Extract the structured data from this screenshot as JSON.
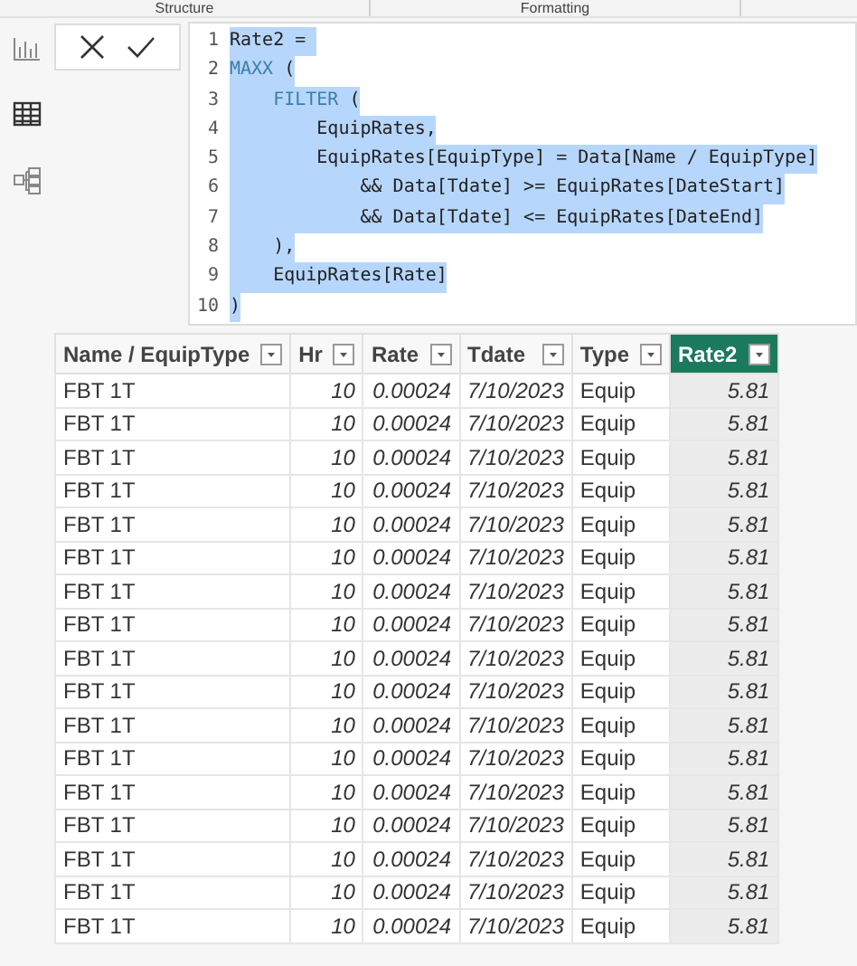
{
  "ribbon": {
    "groups": [
      "Structure",
      "Formatting"
    ]
  },
  "rail": {
    "items": [
      {
        "kind": "report",
        "selected": false
      },
      {
        "kind": "table",
        "selected": true
      },
      {
        "kind": "model",
        "selected": false
      }
    ]
  },
  "formula_bar": {
    "lines": [
      {
        "number": "1",
        "segments": [
          {
            "kind": "plain",
            "text": "Rate2 = "
          }
        ]
      },
      {
        "number": "2",
        "segments": [
          {
            "kind": "function",
            "text": "MAXX"
          },
          {
            "kind": "plain",
            "text": " ("
          }
        ]
      },
      {
        "number": "3",
        "segments": [
          {
            "kind": "function",
            "text": "    FILTER"
          },
          {
            "kind": "plain",
            "text": " ("
          }
        ]
      },
      {
        "number": "4",
        "segments": [
          {
            "kind": "plain",
            "text": "        EquipRates,"
          }
        ]
      },
      {
        "number": "5",
        "segments": [
          {
            "kind": "plain",
            "text": "        EquipRates[EquipType] = Data[Name / EquipType]"
          }
        ]
      },
      {
        "number": "6",
        "segments": [
          {
            "kind": "plain",
            "text": "            && Data[Tdate] >= EquipRates[DateStart]"
          }
        ]
      },
      {
        "number": "7",
        "segments": [
          {
            "kind": "plain",
            "text": "            && Data[Tdate] <= EquipRates[DateEnd]"
          }
        ]
      },
      {
        "number": "8",
        "segments": [
          {
            "kind": "plain",
            "text": "    ),"
          }
        ]
      },
      {
        "number": "9",
        "segments": [
          {
            "kind": "plain",
            "text": "    EquipRates[Rate]"
          }
        ]
      },
      {
        "number": "10",
        "segments": [
          {
            "kind": "plain",
            "text": ")"
          }
        ]
      }
    ]
  },
  "table": {
    "columns": [
      {
        "label": "Name / EquipType",
        "kind": "text",
        "selected": false
      },
      {
        "label": "Hr",
        "kind": "number",
        "selected": false
      },
      {
        "label": "Rate",
        "kind": "number",
        "selected": false
      },
      {
        "label": "Tdate",
        "kind": "number",
        "selected": false
      },
      {
        "label": "Type",
        "kind": "text",
        "selected": false
      },
      {
        "label": "Rate2",
        "kind": "number",
        "selected": true
      }
    ],
    "rows": [
      [
        "FBT 1T",
        "10",
        "0.00024",
        "7/10/2023",
        "Equip",
        "5.81"
      ],
      [
        "FBT 1T",
        "10",
        "0.00024",
        "7/10/2023",
        "Equip",
        "5.81"
      ],
      [
        "FBT 1T",
        "10",
        "0.00024",
        "7/10/2023",
        "Equip",
        "5.81"
      ],
      [
        "FBT 1T",
        "10",
        "0.00024",
        "7/10/2023",
        "Equip",
        "5.81"
      ],
      [
        "FBT 1T",
        "10",
        "0.00024",
        "7/10/2023",
        "Equip",
        "5.81"
      ],
      [
        "FBT 1T",
        "10",
        "0.00024",
        "7/10/2023",
        "Equip",
        "5.81"
      ],
      [
        "FBT 1T",
        "10",
        "0.00024",
        "7/10/2023",
        "Equip",
        "5.81"
      ],
      [
        "FBT 1T",
        "10",
        "0.00024",
        "7/10/2023",
        "Equip",
        "5.81"
      ],
      [
        "FBT 1T",
        "10",
        "0.00024",
        "7/10/2023",
        "Equip",
        "5.81"
      ],
      [
        "FBT 1T",
        "10",
        "0.00024",
        "7/10/2023",
        "Equip",
        "5.81"
      ],
      [
        "FBT 1T",
        "10",
        "0.00024",
        "7/10/2023",
        "Equip",
        "5.81"
      ],
      [
        "FBT 1T",
        "10",
        "0.00024",
        "7/10/2023",
        "Equip",
        "5.81"
      ],
      [
        "FBT 1T",
        "10",
        "0.00024",
        "7/10/2023",
        "Equip",
        "5.81"
      ],
      [
        "FBT 1T",
        "10",
        "0.00024",
        "7/10/2023",
        "Equip",
        "5.81"
      ],
      [
        "FBT 1T",
        "10",
        "0.00024",
        "7/10/2023",
        "Equip",
        "5.81"
      ],
      [
        "FBT 1T",
        "10",
        "0.00024",
        "7/10/2023",
        "Equip",
        "5.81"
      ],
      [
        "FBT 1T",
        "10",
        "0.00024",
        "7/10/2023",
        "Equip",
        "5.81"
      ]
    ]
  }
}
